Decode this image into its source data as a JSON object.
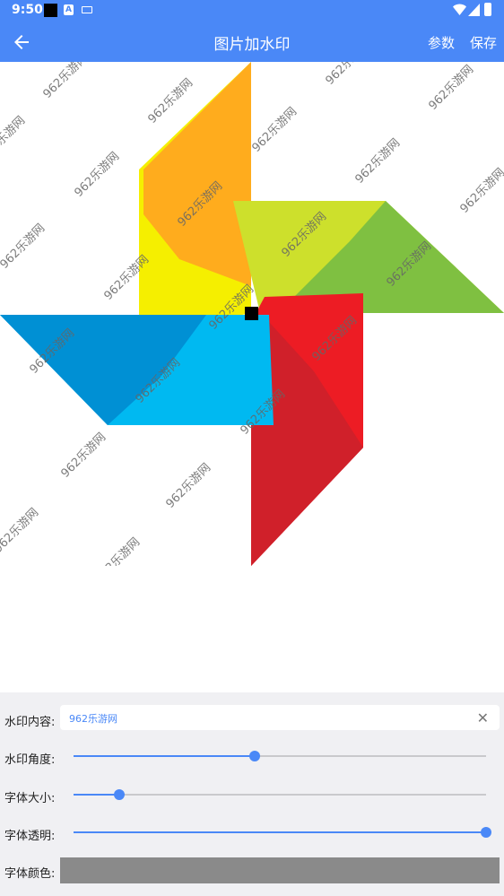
{
  "status_bar": {
    "time": "9:50"
  },
  "app_bar": {
    "title": "图片加水印",
    "params_label": "参数",
    "save_label": "保存"
  },
  "watermark": {
    "text": "962乐游网"
  },
  "controls": {
    "content_label": "水印内容:",
    "content_value": "962乐游网",
    "angle_label": "水印角度:",
    "angle_progress": 0.44,
    "size_label": "字体大小:",
    "size_progress": 0.11,
    "opacity_label": "字体透明:",
    "opacity_progress": 1.0,
    "color_label": "字体颜色:",
    "color_value": "#8a8a8a"
  },
  "colors": {
    "accent": "#4a88f7",
    "panel_bg": "#f0f0f3"
  }
}
